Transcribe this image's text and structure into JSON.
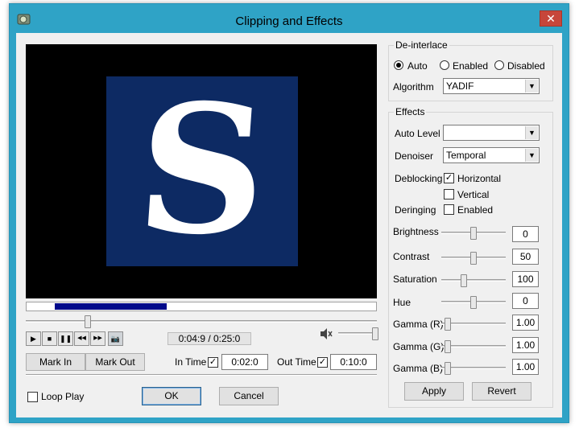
{
  "window": {
    "title": "Clipping and Effects",
    "close_glyph": "✕",
    "app_icon": "app-icon"
  },
  "player": {
    "video_letter": "S",
    "clip_start": 0.08,
    "clip_end": 0.4,
    "seek_position": 0.17,
    "time_display": "0:04:9 / 0:25:0",
    "volume": 1.0,
    "transport": {
      "play_glyph": "▶",
      "stop_glyph": "■",
      "pause_glyph": "❚❚",
      "rewind_glyph": "◀◀",
      "forward_glyph": "▶▶",
      "snapshot_glyph": "📷"
    },
    "mark_in_label": "Mark In",
    "mark_out_label": "Mark Out",
    "in_time_label": "In Time",
    "in_time_checked": true,
    "in_time_value": "0:02:0",
    "out_time_label": "Out Time",
    "out_time_checked": true,
    "out_time_value": "0:10:0",
    "check_glyph": "✓"
  },
  "footer": {
    "loop_play_label": "Loop Play",
    "loop_play_checked": false,
    "ok_label": "OK",
    "cancel_label": "Cancel"
  },
  "deinterlace": {
    "group_title": "De-interlace",
    "options": [
      "Auto",
      "Enabled",
      "Disabled"
    ],
    "selected": "Auto",
    "algorithm_label": "Algorithm",
    "algorithm_value": "YADIF"
  },
  "effects": {
    "group_title": "Effects",
    "auto_level_label": "Auto Level",
    "auto_level_value": "",
    "denoiser_label": "Denoiser",
    "denoiser_value": "Temporal",
    "deblocking_label": "Deblocking",
    "horizontal_label": "Horizontal",
    "horizontal_checked": true,
    "vertical_label": "Vertical",
    "vertical_checked": false,
    "deringing_label": "Deringing",
    "deringing_enabled_label": "Enabled",
    "deringing_checked": false,
    "sliders": [
      {
        "label": "Brightness",
        "value": "0",
        "position": 0.5
      },
      {
        "label": "Contrast",
        "value": "50",
        "position": 0.5
      },
      {
        "label": "Saturation",
        "value": "100",
        "position": 0.33
      },
      {
        "label": "Hue",
        "value": "0",
        "position": 0.5
      },
      {
        "label": "Gamma (R)",
        "value": "1.00",
        "position": 0.05
      },
      {
        "label": "Gamma (G)",
        "value": "1.00",
        "position": 0.05
      },
      {
        "label": "Gamma (B)",
        "value": "1.00",
        "position": 0.05
      }
    ],
    "apply_label": "Apply",
    "revert_label": "Revert"
  }
}
